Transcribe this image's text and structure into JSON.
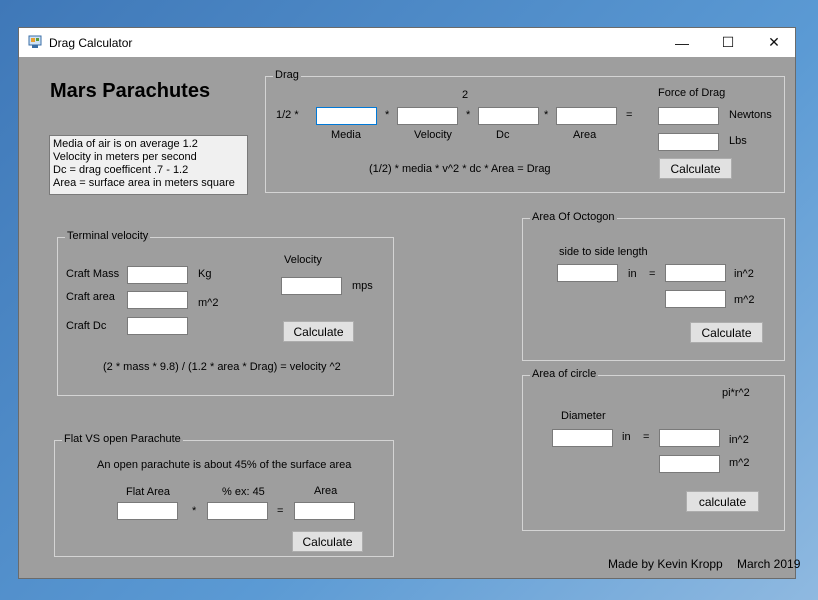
{
  "window": {
    "title": "Drag Calculator",
    "minimize": "—",
    "maximize": "☐",
    "close": "✕"
  },
  "heading": "Mars Parachutes",
  "notes": [
    "Media of air is on average 1.2",
    "Velocity in meters per second",
    "Dc = drag coefficent .7 - 1.2",
    "Area = surface area in meters square"
  ],
  "drag": {
    "label": "Drag",
    "half": "1/2 *",
    "exponent": "2",
    "dot": "*",
    "equals": "=",
    "media": "Media",
    "velocity": "Velocity",
    "dc": "Dc",
    "area": "Area",
    "force_label": "Force of Drag",
    "newtons": "Newtons",
    "lbs": "Lbs",
    "calculate": "Calculate",
    "formula": "(1/2) * media * v^2 * dc * Area = Drag"
  },
  "terminal": {
    "label": "Terminal velocity",
    "craft_mass": "Craft Mass",
    "craft_area": "Craft area",
    "craft_dc": "Craft Dc",
    "kg": "Kg",
    "m2": "m^2",
    "velocity": "Velocity",
    "mps": "mps",
    "calculate": "Calculate",
    "formula": "(2 * mass * 9.8) / (1.2  * area * Drag) = velocity ^2"
  },
  "octogon": {
    "label": "Area Of Octogon",
    "side_label": "side to side length",
    "in": "in",
    "equals": "=",
    "in2": "in^2",
    "m2": "m^2",
    "calculate": "Calculate"
  },
  "circle": {
    "label": "Area of circle",
    "pi": "pi*r^2",
    "diameter": "Diameter",
    "in": "in",
    "equals": "=",
    "in2": "in^2",
    "m2": "m^2",
    "calculate": "calculate"
  },
  "flat": {
    "label": "Flat VS open Parachute",
    "desc": "An open parachute is about 45% of the surface area",
    "flat_area": "Flat Area",
    "percent": "%    ex: 45",
    "area": "Area",
    "dot": "*",
    "equals": "=",
    "calculate": "Calculate"
  },
  "footer": {
    "author": "Made by Kevin Kropp",
    "date": "March 2019"
  }
}
